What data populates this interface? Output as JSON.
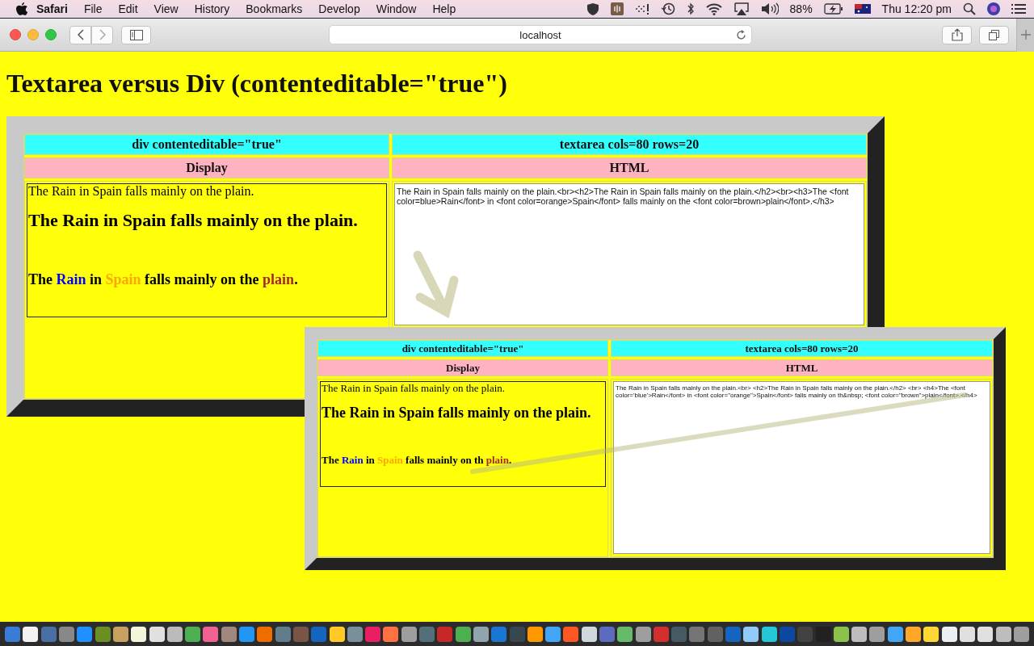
{
  "menu_bar": {
    "app_name": "Safari",
    "menus": [
      "File",
      "Edit",
      "View",
      "History",
      "Bookmarks",
      "Develop",
      "Window",
      "Help"
    ],
    "battery": "88%",
    "clock": "Thu 12:20 pm"
  },
  "toolbar": {
    "address": "localhost"
  },
  "page": {
    "heading": "Textarea versus Div (contenteditable=\"true\")",
    "panels": [
      {
        "kind": "main",
        "headers": [
          "div contenteditable=\"true\"",
          "textarea cols=80 rows=20"
        ],
        "subheaders": [
          "Display",
          "HTML"
        ],
        "display": {
          "line_1": "The Rain in Spain falls mainly on the plain.",
          "line_2": "The Rain in Spain falls mainly on the plain.",
          "line_3": [
            {
              "text": "The "
            },
            {
              "text": "Rain",
              "color": "#0000ff"
            },
            {
              "text": " in "
            },
            {
              "text": "Spain",
              "color": "#ffa500"
            },
            {
              "text": " falls mainly on the "
            },
            {
              "text": "plain",
              "color": "#a52a2a"
            },
            {
              "text": "."
            }
          ]
        },
        "textarea": "The Rain in Spain falls mainly on the plain.<br><h2>The Rain in Spain falls mainly on the plain.</h2><br><h3>The <font color=blue>Rain</font> in <font color=orange>Spain</font> falls mainly on the <font color=brown>plain</font>.</h3>"
      },
      {
        "kind": "inset",
        "headers": [
          "div contenteditable=\"true\"",
          "textarea cols=80 rows=20"
        ],
        "subheaders": [
          "Display",
          "HTML"
        ],
        "display": {
          "line_1": "The Rain in Spain falls mainly on the plain.",
          "line_2": "The Rain in Spain falls mainly on the plain.",
          "line_3": [
            {
              "text": "The "
            },
            {
              "text": "Rain",
              "color": "#0000ff"
            },
            {
              "text": " in "
            },
            {
              "text": "Spain",
              "color": "#ffa500"
            },
            {
              "text": " falls mainly on th "
            },
            {
              "text": "plain",
              "color": "#a52a2a"
            },
            {
              "text": "."
            }
          ]
        },
        "textarea": "The Rain in Spain falls mainly on the plain.<br> <h2>The Rain in Spain falls mainly on the plain.</h2> <br> <h4>The <font color='blue'>Rain</font> in <font color=\"orange\">Spain</font> falls mainly on th&nbsp; <font color=\"brown\">plain</font>.</h4>"
      }
    ]
  }
}
